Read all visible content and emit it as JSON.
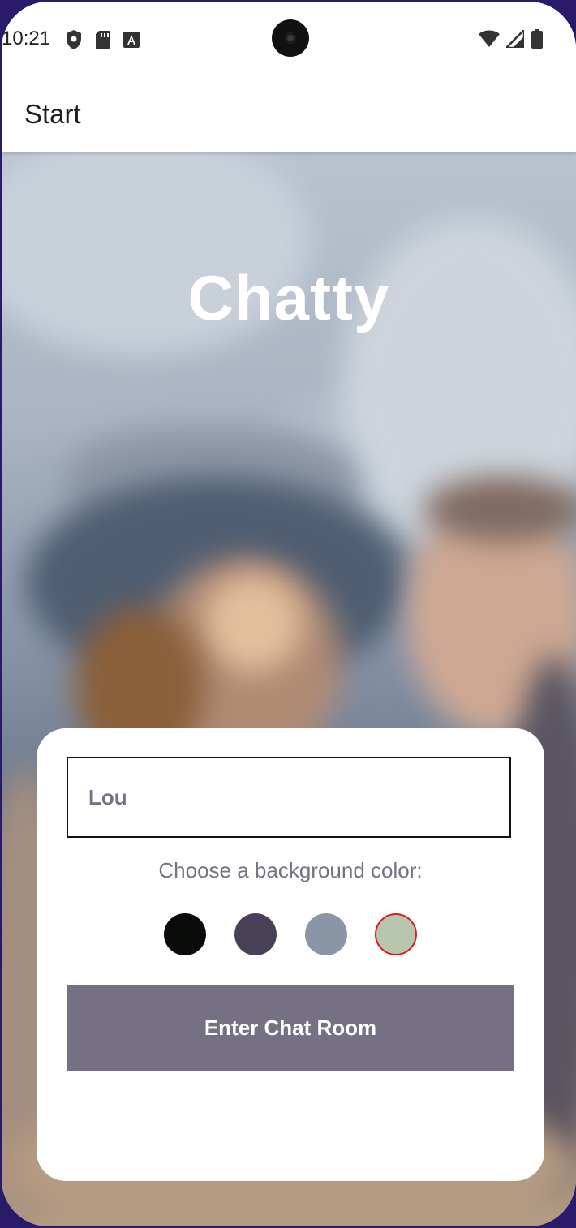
{
  "status_bar": {
    "time": "10:21"
  },
  "app_bar": {
    "title": "Start"
  },
  "main": {
    "app_name": "Chatty"
  },
  "card": {
    "name_input": {
      "value": "Lou"
    },
    "color_label": "Choose a background color:",
    "colors": [
      {
        "name": "black",
        "hex": "#090C08",
        "selected": false
      },
      {
        "name": "purple",
        "hex": "#474056",
        "selected": false
      },
      {
        "name": "blue-grey",
        "hex": "#8A95A5",
        "selected": false
      },
      {
        "name": "green",
        "hex": "#B9C6AE",
        "selected": true
      }
    ],
    "button_label": "Enter Chat Room"
  },
  "colors": {
    "button_bg": "#757083",
    "text": "#757083",
    "selected_ring": "#e01818"
  }
}
